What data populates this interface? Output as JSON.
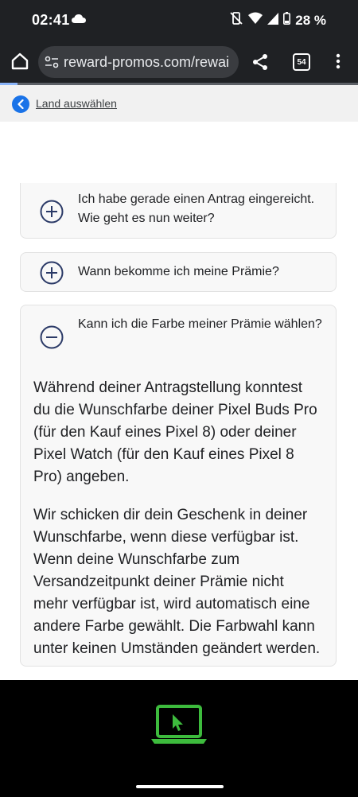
{
  "status": {
    "time": "02:41",
    "battery": "28 %"
  },
  "toolbar": {
    "url": "reward-promos.com/rewai",
    "tab_count": "54"
  },
  "page": {
    "back_link": "Land auswählen",
    "faq": [
      {
        "question": "Ich habe gerade einen Antrag eingereicht. Wie geht es nun weiter?",
        "expanded": false
      },
      {
        "question": "Wann bekomme ich meine Prämie?",
        "expanded": false
      },
      {
        "question": "Kann ich die Farbe meiner Prämie wählen?",
        "expanded": true,
        "answer": [
          "Während deiner Antragstellung konntest du die Wunschfarbe deiner Pixel Buds Pro (für den Kauf eines Pixel 8) oder deiner Pixel Watch (für den Kauf eines Pixel 8 Pro) angeben.",
          "Wir schicken dir dein Geschenk in deiner Wunschfarbe, wenn diese verfügbar ist. Wenn deine Wunschfarbe zum Versandzeitpunkt deiner Prämie nicht mehr verfügbar ist, wird automatisch eine andere Farbe gewählt. Die Farbwahl kann unter keinen Umständen geändert werden."
        ]
      }
    ]
  },
  "colors": {
    "accent": "#1a73e8",
    "icon_navy": "#2b3a67",
    "laptop_green": "#3dbb3d"
  }
}
